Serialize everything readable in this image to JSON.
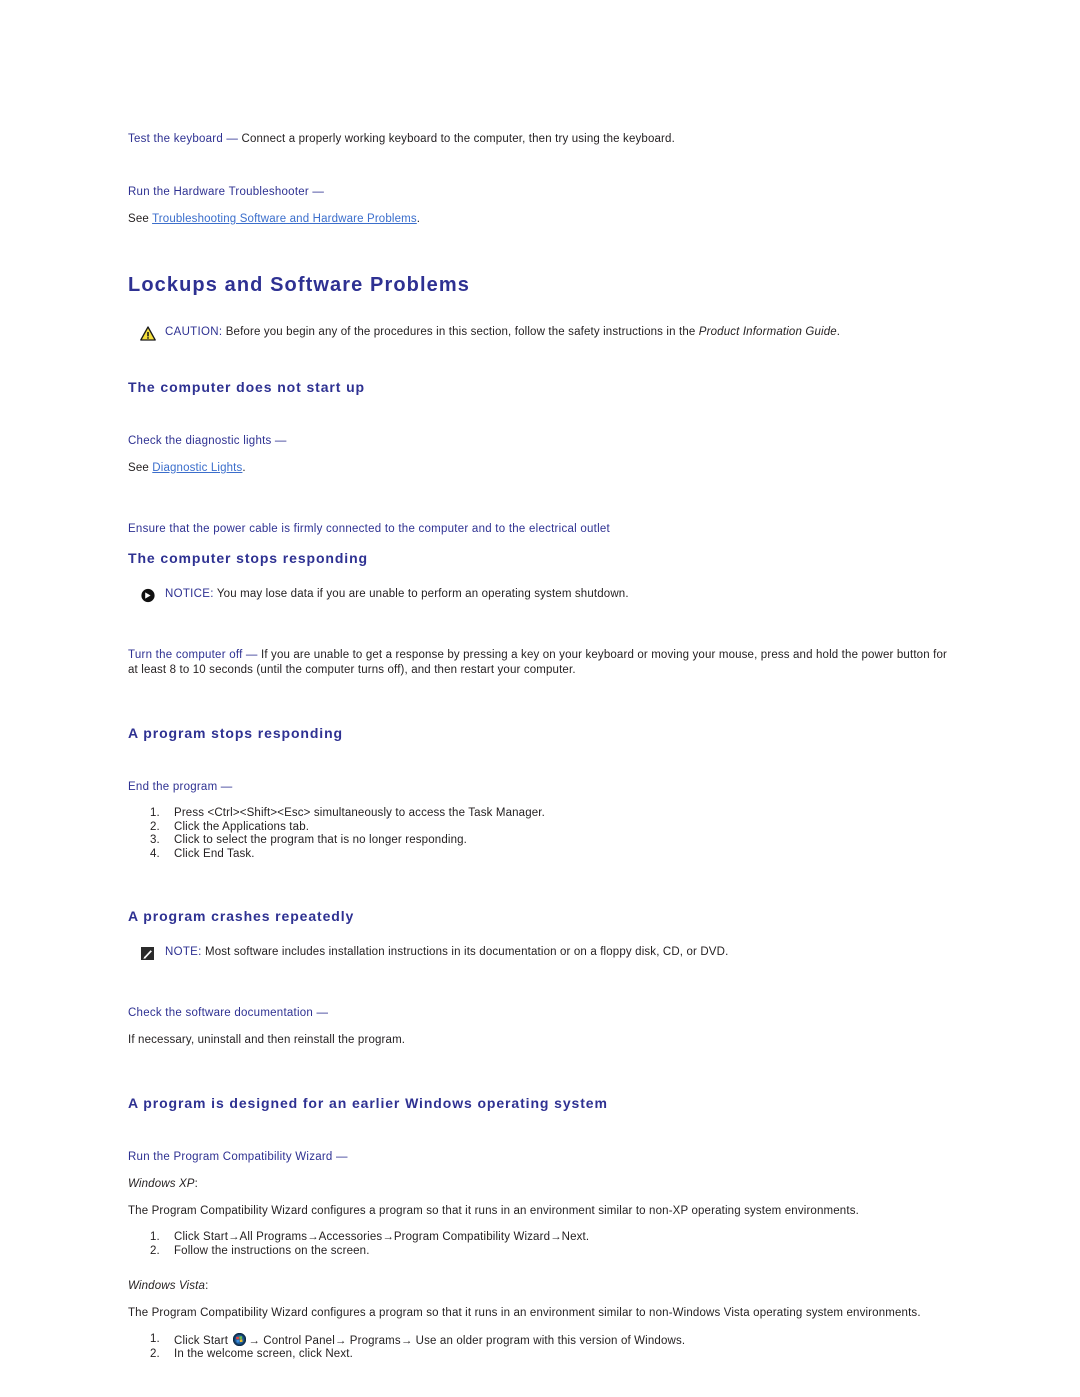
{
  "doc": {
    "intro": {
      "test_keyboard_lead": "Test the keyboard",
      "dash": "—",
      "test_keyboard_body": "Connect a properly working keyboard to the computer, then try using the keyboard.",
      "hw_troubleshooter_lead": "Run the Hardware Troubleshooter",
      "see_word": "See",
      "hw_troubleshooter_link": "Troubleshooting Software and Hardware Problems",
      "period": "."
    },
    "section_title": "Lockups and Software Problems",
    "caution": {
      "icon": "warning-triangle-icon",
      "label": "CAUTION:",
      "text_before": " Before you begin any of the procedures in this section, follow the safety instructions in the ",
      "italic_text": "Product Information Guide",
      "text_after": "."
    },
    "subsections": [
      {
        "id": "computer-does-not-start-up",
        "title": "The computer does not start up",
        "diagnostic_lead": "Check the diagnostic lights",
        "dash": "—",
        "see_word": "See",
        "diagnostic_link": "Diagnostic Lights",
        "period": ".",
        "power_cable_lead": "Ensure that the power cable is firmly connected to the computer and to the electrical outlet"
      },
      {
        "id": "computer-stops-responding",
        "title": "The computer stops responding",
        "notice": {
          "icon": "notice-arrow-icon",
          "label": "NOTICE:",
          "text": " You may lose data if you are unable to perform an operating system shutdown."
        },
        "turn_off_lead": "Turn the computer off",
        "dash": "—",
        "turn_off_body": " If you are unable to get a response by pressing a key on your keyboard or moving your mouse, press and hold the power button for at least 8 to 10 seconds (until the computer turns off), and then restart your computer."
      },
      {
        "id": "program-stops-responding",
        "title": "A program stops responding",
        "end_program_lead": "End the program",
        "dash": "—",
        "steps": [
          {
            "num": "1.",
            "text": "Press <Ctrl><Shift><Esc> simultaneously to access the Task Manager."
          },
          {
            "num": "2.",
            "text": "Click the Applications tab."
          },
          {
            "num": "3.",
            "text": "Click to select the program that is no longer responding."
          },
          {
            "num": "4.",
            "text": "Click End Task."
          }
        ]
      },
      {
        "id": "program-crashes-repeatedly",
        "title": "A program crashes repeatedly",
        "note": {
          "icon": "note-pencil-icon",
          "label": "NOTE:",
          "text": " Most software includes installation instructions in its documentation or on a floppy disk, CD, or DVD."
        },
        "check_docs_lead": "Check the software documentation",
        "dash": "—",
        "check_docs_body": "If necessary, uninstall and then reinstall the program."
      },
      {
        "id": "program-earlier-windows",
        "title": "A program is designed for an earlier Windows operating system",
        "wizard_lead": "Run the Program Compatibility Wizard",
        "dash": "—",
        "xp": {
          "os_label": "Windows XP",
          "os_label_punct": ":",
          "intro": "The Program Compatibility Wizard configures a program so that it runs in an environment similar to non-XP operating system environments.",
          "steps": [
            {
              "num": "1.",
              "parts": [
                "Click Start",
                "All Programs",
                "Accessories",
                "Program Compatibility Wizard",
                "Next."
              ],
              "arrow": "→"
            },
            {
              "num": "2.",
              "text": "Follow the instructions on the screen."
            }
          ]
        },
        "vista": {
          "os_label": "Windows Vista",
          "os_label_punct": ":",
          "intro": "The Program Compatibility Wizard configures a program so that it runs in an environment similar to non-Windows Vista operating system environments.",
          "step1_prefix": "Click Start",
          "step1_icon": "windows-vista-start-orb-icon",
          "step1_parts": [
            "Control Panel",
            "Programs",
            "Use an older program with this version of Windows."
          ],
          "arrow": "→",
          "num1": "1.",
          "num2": "2.",
          "step2_text": "In the welcome screen, click Next."
        }
      }
    ]
  },
  "colors": {
    "heading_blue": "#2e3192",
    "link_blue": "#3b6ecc",
    "body_black": "#231f20",
    "caution_yellow": "#f5e03c"
  }
}
